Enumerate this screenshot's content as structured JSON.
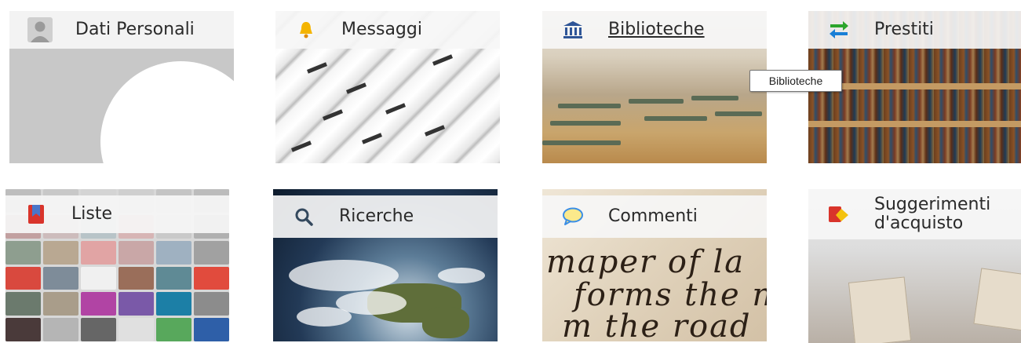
{
  "tiles": [
    {
      "label": "Dati Personali",
      "icon": "user-avatar-icon"
    },
    {
      "label": "Messaggi",
      "icon": "bell-icon"
    },
    {
      "label": "Biblioteche",
      "icon": "library-building-icon"
    },
    {
      "label": "Prestiti",
      "icon": "swap-arrows-icon"
    },
    {
      "label": "Liste",
      "icon": "bookmark-book-icon"
    },
    {
      "label": "Ricerche",
      "icon": "search-icon"
    },
    {
      "label": "Commenti",
      "icon": "speech-bubble-icon"
    },
    {
      "label": "Suggerimenti d'acquisto",
      "icon": "ballot-suggestion-icon"
    }
  ],
  "tooltip": {
    "text": "Biblioteche"
  },
  "colors": {
    "bell": "#f4b400",
    "library": "#2f5597",
    "swap_green": "#2ca52c",
    "swap_blue": "#1a7fd6",
    "bookmark_red": "#d9342b",
    "bookmark_blue": "#4a76c9",
    "bubble_blue": "#3a8ee6",
    "bubble_yellow": "#fbe98b",
    "search_dark": "#34495e",
    "ballot_red": "#d9342b",
    "ballot_yellow": "#f4c20d"
  }
}
